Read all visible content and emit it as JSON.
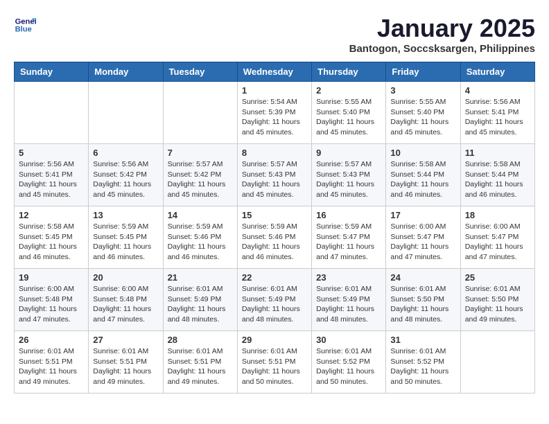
{
  "logo": {
    "line1": "General",
    "line2": "Blue"
  },
  "title": "January 2025",
  "subtitle": "Bantogon, Soccsksargen, Philippines",
  "headers": [
    "Sunday",
    "Monday",
    "Tuesday",
    "Wednesday",
    "Thursday",
    "Friday",
    "Saturday"
  ],
  "weeks": [
    [
      {
        "day": "",
        "content": ""
      },
      {
        "day": "",
        "content": ""
      },
      {
        "day": "",
        "content": ""
      },
      {
        "day": "1",
        "content": "Sunrise: 5:54 AM\nSunset: 5:39 PM\nDaylight: 11 hours and 45 minutes."
      },
      {
        "day": "2",
        "content": "Sunrise: 5:55 AM\nSunset: 5:40 PM\nDaylight: 11 hours and 45 minutes."
      },
      {
        "day": "3",
        "content": "Sunrise: 5:55 AM\nSunset: 5:40 PM\nDaylight: 11 hours and 45 minutes."
      },
      {
        "day": "4",
        "content": "Sunrise: 5:56 AM\nSunset: 5:41 PM\nDaylight: 11 hours and 45 minutes."
      }
    ],
    [
      {
        "day": "5",
        "content": "Sunrise: 5:56 AM\nSunset: 5:41 PM\nDaylight: 11 hours and 45 minutes."
      },
      {
        "day": "6",
        "content": "Sunrise: 5:56 AM\nSunset: 5:42 PM\nDaylight: 11 hours and 45 minutes."
      },
      {
        "day": "7",
        "content": "Sunrise: 5:57 AM\nSunset: 5:42 PM\nDaylight: 11 hours and 45 minutes."
      },
      {
        "day": "8",
        "content": "Sunrise: 5:57 AM\nSunset: 5:43 PM\nDaylight: 11 hours and 45 minutes."
      },
      {
        "day": "9",
        "content": "Sunrise: 5:57 AM\nSunset: 5:43 PM\nDaylight: 11 hours and 45 minutes."
      },
      {
        "day": "10",
        "content": "Sunrise: 5:58 AM\nSunset: 5:44 PM\nDaylight: 11 hours and 46 minutes."
      },
      {
        "day": "11",
        "content": "Sunrise: 5:58 AM\nSunset: 5:44 PM\nDaylight: 11 hours and 46 minutes."
      }
    ],
    [
      {
        "day": "12",
        "content": "Sunrise: 5:58 AM\nSunset: 5:45 PM\nDaylight: 11 hours and 46 minutes."
      },
      {
        "day": "13",
        "content": "Sunrise: 5:59 AM\nSunset: 5:45 PM\nDaylight: 11 hours and 46 minutes."
      },
      {
        "day": "14",
        "content": "Sunrise: 5:59 AM\nSunset: 5:46 PM\nDaylight: 11 hours and 46 minutes."
      },
      {
        "day": "15",
        "content": "Sunrise: 5:59 AM\nSunset: 5:46 PM\nDaylight: 11 hours and 46 minutes."
      },
      {
        "day": "16",
        "content": "Sunrise: 5:59 AM\nSunset: 5:47 PM\nDaylight: 11 hours and 47 minutes."
      },
      {
        "day": "17",
        "content": "Sunrise: 6:00 AM\nSunset: 5:47 PM\nDaylight: 11 hours and 47 minutes."
      },
      {
        "day": "18",
        "content": "Sunrise: 6:00 AM\nSunset: 5:47 PM\nDaylight: 11 hours and 47 minutes."
      }
    ],
    [
      {
        "day": "19",
        "content": "Sunrise: 6:00 AM\nSunset: 5:48 PM\nDaylight: 11 hours and 47 minutes."
      },
      {
        "day": "20",
        "content": "Sunrise: 6:00 AM\nSunset: 5:48 PM\nDaylight: 11 hours and 47 minutes."
      },
      {
        "day": "21",
        "content": "Sunrise: 6:01 AM\nSunset: 5:49 PM\nDaylight: 11 hours and 48 minutes."
      },
      {
        "day": "22",
        "content": "Sunrise: 6:01 AM\nSunset: 5:49 PM\nDaylight: 11 hours and 48 minutes."
      },
      {
        "day": "23",
        "content": "Sunrise: 6:01 AM\nSunset: 5:49 PM\nDaylight: 11 hours and 48 minutes."
      },
      {
        "day": "24",
        "content": "Sunrise: 6:01 AM\nSunset: 5:50 PM\nDaylight: 11 hours and 48 minutes."
      },
      {
        "day": "25",
        "content": "Sunrise: 6:01 AM\nSunset: 5:50 PM\nDaylight: 11 hours and 49 minutes."
      }
    ],
    [
      {
        "day": "26",
        "content": "Sunrise: 6:01 AM\nSunset: 5:51 PM\nDaylight: 11 hours and 49 minutes."
      },
      {
        "day": "27",
        "content": "Sunrise: 6:01 AM\nSunset: 5:51 PM\nDaylight: 11 hours and 49 minutes."
      },
      {
        "day": "28",
        "content": "Sunrise: 6:01 AM\nSunset: 5:51 PM\nDaylight: 11 hours and 49 minutes."
      },
      {
        "day": "29",
        "content": "Sunrise: 6:01 AM\nSunset: 5:51 PM\nDaylight: 11 hours and 50 minutes."
      },
      {
        "day": "30",
        "content": "Sunrise: 6:01 AM\nSunset: 5:52 PM\nDaylight: 11 hours and 50 minutes."
      },
      {
        "day": "31",
        "content": "Sunrise: 6:01 AM\nSunset: 5:52 PM\nDaylight: 11 hours and 50 minutes."
      },
      {
        "day": "",
        "content": ""
      }
    ]
  ]
}
